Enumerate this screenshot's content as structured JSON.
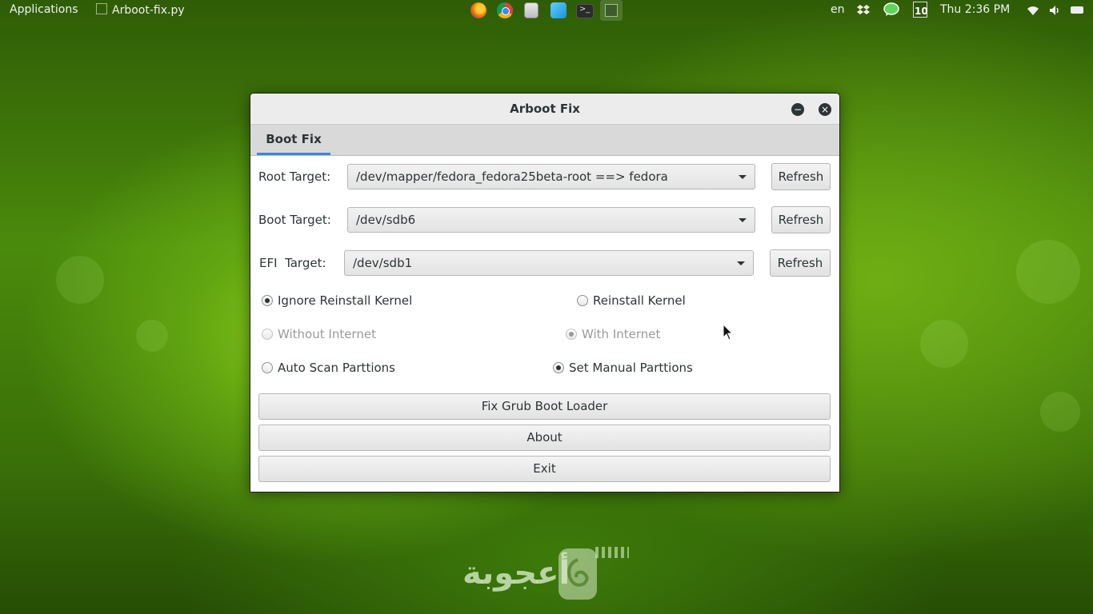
{
  "topbar": {
    "applications": "Applications",
    "active_window": "Arboot-fix.py",
    "language": "en",
    "clock": "Thu  2:36 PM",
    "calendar_day": "10",
    "launcher_icons": [
      "firefox-icon",
      "chrome-icon",
      "files-icon",
      "box-icon",
      "terminal-icon",
      "notes-icon"
    ]
  },
  "window": {
    "title": "Arboot Fix",
    "tab_label": "Boot Fix",
    "root_label": "Root Target:",
    "root_value": "/dev/mapper/fedora_fedora25beta-root ==> fedora",
    "boot_label": "Boot Target:",
    "boot_value": "/dev/sdb6",
    "efi_label": "EFI  Target:",
    "efi_value": "/dev/sdb1",
    "refresh_label": "Refresh",
    "options": {
      "ignore_reinstall": "Ignore Reinstall Kernel",
      "reinstall": "Reinstall Kernel",
      "without_internet": "Without Internet",
      "with_internet": "With Internet",
      "auto_scan": "Auto Scan Parttions",
      "manual": "Set Manual Parttions"
    },
    "fix_button": "Fix Grub Boot Loader",
    "about_button": "About",
    "exit_button": "Exit"
  },
  "watermark": "أعجوبة",
  "colors": {
    "accent": "#3a87e0",
    "text": "#2e3436"
  }
}
